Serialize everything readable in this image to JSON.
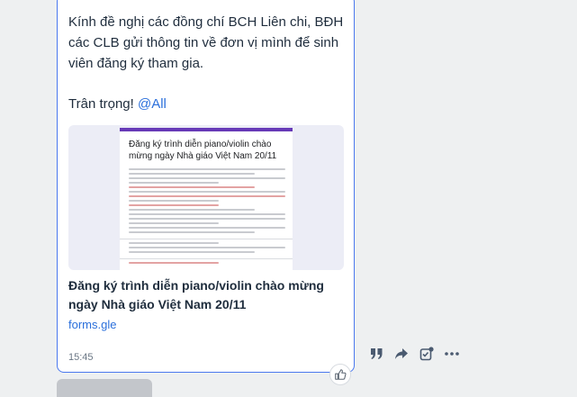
{
  "message": {
    "line1": "Kính đề nghị các đồng chí BCH Liên chi, BĐH các CLB gửi thông tin về đơn vị mình để sinh viên đăng ký tham gia.",
    "closing": "Trân trọng!",
    "mention": "@All",
    "time": "15:45"
  },
  "link_preview": {
    "form_heading": "Đăng ký trình diễn piano/violin chào mừng ngày Nhà giáo Việt Nam 20/11",
    "title": "Đăng ký trình diễn piano/violin chào mừng ngày Nhà giáo Việt Nam 20/11",
    "domain": "forms.gle"
  },
  "actions": [
    {
      "name": "quote-icon"
    },
    {
      "name": "share-icon"
    },
    {
      "name": "add-task-icon"
    },
    {
      "name": "more-icon"
    }
  ],
  "reaction": {
    "icon": "thumbs-up-icon"
  },
  "colors": {
    "accent": "#4a78ef",
    "link": "#2a6fdb",
    "form_header": "#673ab7"
  }
}
